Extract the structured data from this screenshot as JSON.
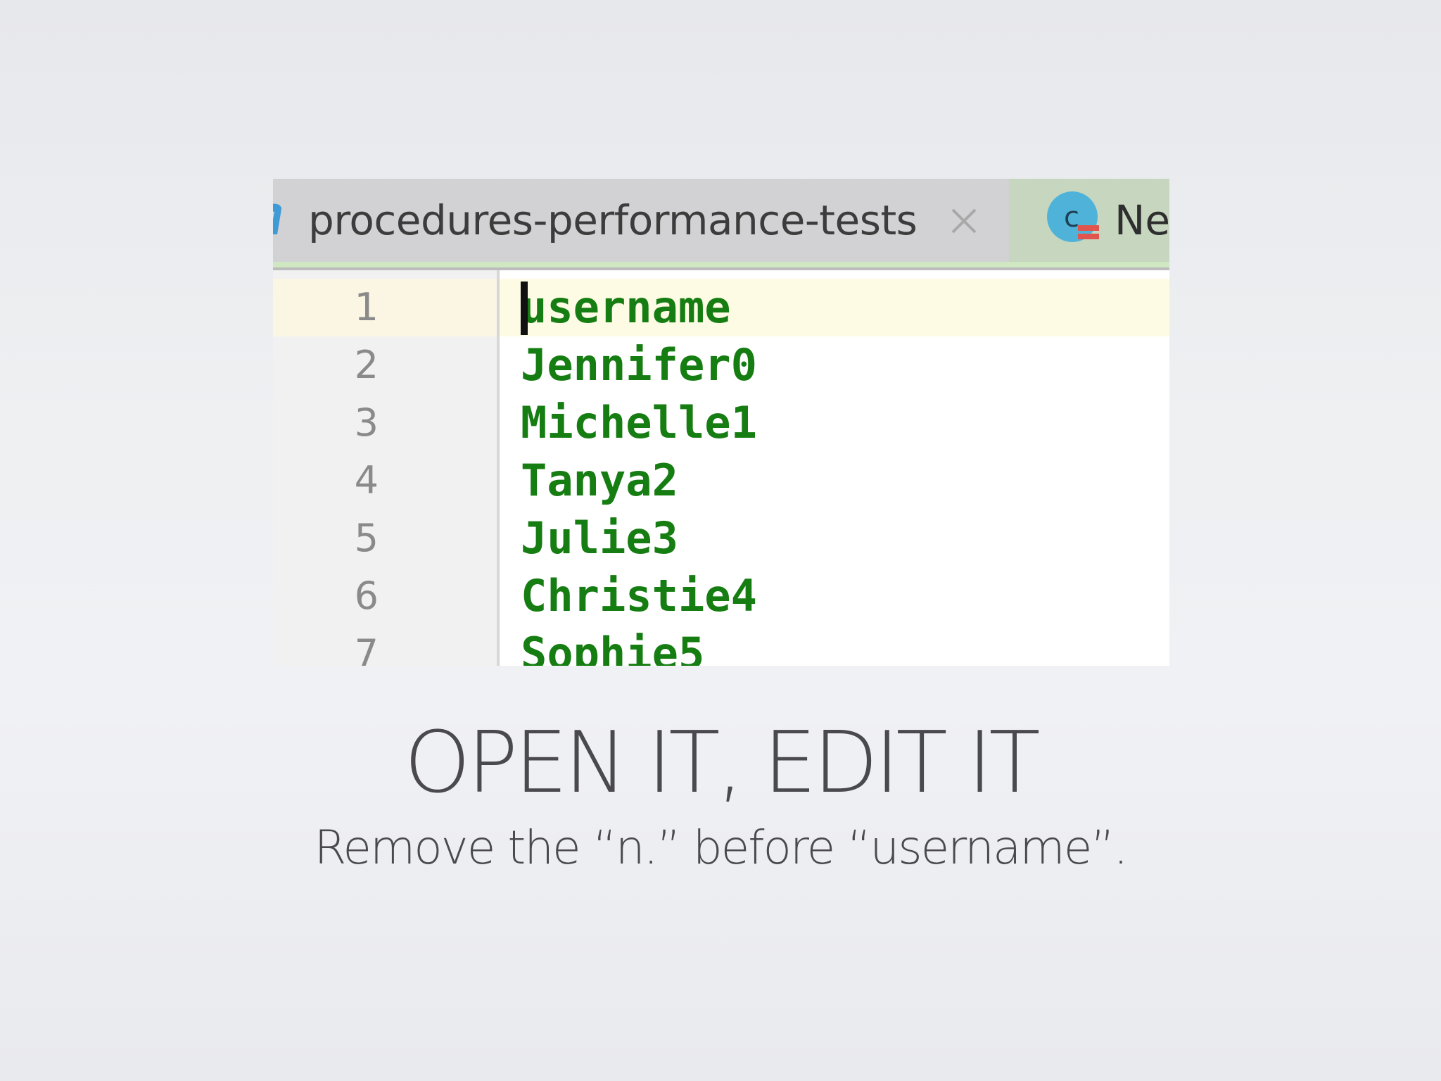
{
  "editor": {
    "active_tab": {
      "label": "procedures-performance-tests",
      "icon": "file-icon",
      "close_icon": "close-icon"
    },
    "inactive_tab": {
      "label": "Ne",
      "icon": "class-icon",
      "icon_letter": "c"
    },
    "lines": [
      {
        "number": "1",
        "text": "username"
      },
      {
        "number": "2",
        "text": "Jennifer0"
      },
      {
        "number": "3",
        "text": "Michelle1"
      },
      {
        "number": "4",
        "text": "Tanya2"
      },
      {
        "number": "5",
        "text": "Julie3"
      },
      {
        "number": "6",
        "text": "Christie4"
      },
      {
        "number": "7",
        "text": "Sophie5"
      }
    ],
    "colors": {
      "code_text": "#167d12",
      "line_numbers": "#8a8a8a",
      "current_line": "#fdfbe4",
      "tab_bar": "#d4d4d6",
      "inactive_tab": "#c6d6bf"
    }
  },
  "slide": {
    "title": "OPEN IT, EDIT IT",
    "subtitle": "Remove the “n.” before “username”."
  }
}
